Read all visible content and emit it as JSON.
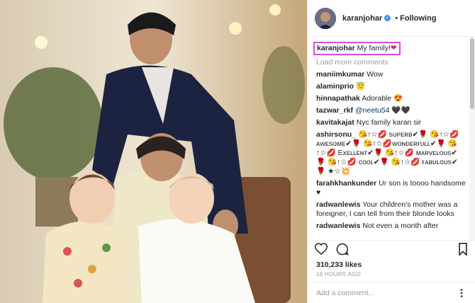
{
  "header": {
    "username": "karanjohar",
    "follow_label": "Following",
    "separator": "•"
  },
  "caption": {
    "user": "karanjohar",
    "text": "My family!",
    "emoji": "❤"
  },
  "load_more": "Load more comments",
  "comments": [
    {
      "user": "maniimkumar",
      "text": "Wow"
    },
    {
      "user": "alaminprio",
      "text": "😇"
    },
    {
      "user": "hinnapathak",
      "text": "Adorable 😍"
    },
    {
      "user": "tazwar_rkf",
      "mention": "@neetu54",
      "text": "🖤🖤"
    },
    {
      "user": "kavitakajat",
      "text": "Nyc family karan sir"
    },
    {
      "user": "ashirsonu_",
      "text": "😘↑☆💋 sᴜᴘᴇʀʙ✔🌹 😘↑☆💋 ᴀᴡᴇsᴏᴍᴇ✔🌹 😘↑☆💋ᴡᴏɴᴅᴇʀғᴜʟʟ✔🌹 😘↑☆💋 Exᴇʟʟᴇɴᴛ✔🌹 😘↑☆💋 ᴍᴀʀᴠᴇʟᴏᴜs✔🌹 😘↑☆💋 ᴄᴏᴏʟ✔🌹 😘↑☆💋 ғᴀʙᴜʟᴏᴜs✔🌹 ★☆💥"
    },
    {
      "user": "farahkhankunder",
      "text": "Ur son is toooo handsome ♥"
    },
    {
      "user": "radwanlewis",
      "text": "Your children's mother was a foreigner, I can tell from their blonde looks"
    },
    {
      "user": "radwanlewis",
      "text": "Not even a month after"
    }
  ],
  "likes": "310,233 likes",
  "time": "16 HOURS AGO",
  "add_comment_placeholder": "Add a comment...",
  "icons": {
    "like": "heart-icon",
    "comment": "comment-icon",
    "save": "bookmark-icon",
    "options": "more-options-icon"
  },
  "colors": {
    "verified": "#3897f0",
    "highlight": "#d64fd8",
    "text": "#262626",
    "muted": "#999999"
  }
}
